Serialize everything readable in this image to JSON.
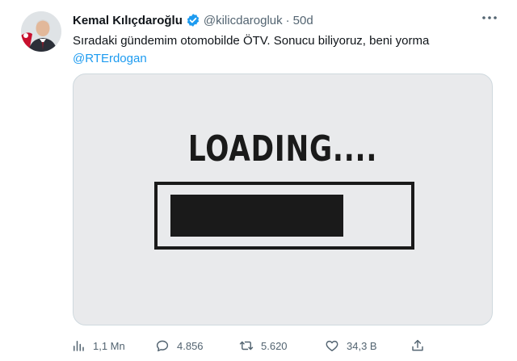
{
  "tweet": {
    "author": {
      "display_name": "Kemal Kılıçdaroğlu",
      "handle": "@kilicdarogluk",
      "verified": true,
      "time": "50d"
    },
    "text": "Sıradaki gündemim otomobilde ÖTV. Sonucu biliyoruz, beni yorma",
    "mention": "@RTErdogan",
    "media": {
      "loading_text": "LOADING....",
      "progress_fraction": 0.76
    },
    "actions": {
      "views": "1,1 Mn",
      "replies": "4.856",
      "retweets": "5.620",
      "likes": "34,3 B"
    },
    "icons": {
      "more": "more-horizontal-icon",
      "verified": "verified-badge-icon",
      "views": "analytics-icon",
      "reply": "reply-icon",
      "retweet": "retweet-icon",
      "like": "heart-icon",
      "share": "share-icon"
    },
    "colors": {
      "accent": "#1d9bf0",
      "secondary_text": "#536471",
      "primary_text": "#0f1419"
    }
  }
}
